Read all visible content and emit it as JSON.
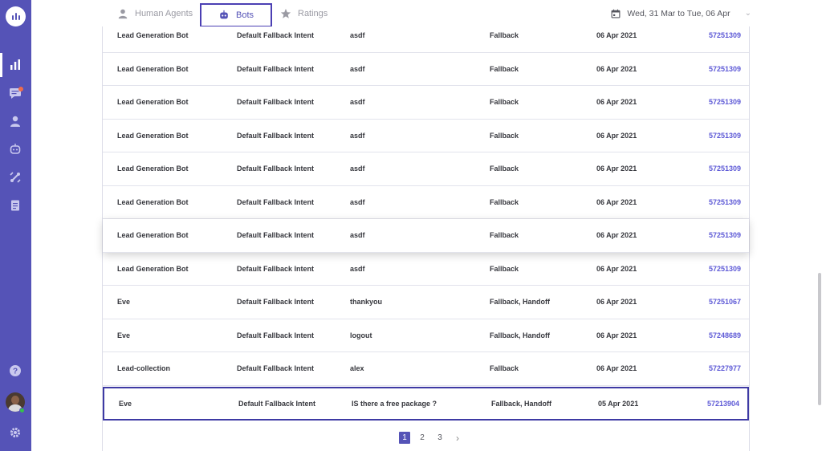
{
  "sidebar": {
    "icons": [
      "logo-icon",
      "analytics-icon",
      "conversations-icon",
      "contacts-icon",
      "bot-icon",
      "integrations-icon",
      "reports-icon",
      "help-icon",
      "settings-icon"
    ]
  },
  "tabs": [
    {
      "label": "Human Agents"
    },
    {
      "label": "Bots"
    },
    {
      "label": "Ratings"
    }
  ],
  "date_range": "Wed, 31 Mar to Tue, 06 Apr",
  "rows": [
    {
      "bot": "Lead Generation Bot",
      "intent": "Default Fallback Intent",
      "message": "asdf",
      "type": "Fallback",
      "date": "06 Apr 2021",
      "id": "57251309"
    },
    {
      "bot": "Lead Generation Bot",
      "intent": "Default Fallback Intent",
      "message": "asdf",
      "type": "Fallback",
      "date": "06 Apr 2021",
      "id": "57251309"
    },
    {
      "bot": "Lead Generation Bot",
      "intent": "Default Fallback Intent",
      "message": "asdf",
      "type": "Fallback",
      "date": "06 Apr 2021",
      "id": "57251309"
    },
    {
      "bot": "Lead Generation Bot",
      "intent": "Default Fallback Intent",
      "message": "asdf",
      "type": "Fallback",
      "date": "06 Apr 2021",
      "id": "57251309"
    },
    {
      "bot": "Lead Generation Bot",
      "intent": "Default Fallback Intent",
      "message": "asdf",
      "type": "Fallback",
      "date": "06 Apr 2021",
      "id": "57251309"
    },
    {
      "bot": "Lead Generation Bot",
      "intent": "Default Fallback Intent",
      "message": "asdf",
      "type": "Fallback",
      "date": "06 Apr 2021",
      "id": "57251309"
    },
    {
      "bot": "Lead Generation Bot",
      "intent": "Default Fallback Intent",
      "message": "asdf",
      "type": "Fallback",
      "date": "06 Apr 2021",
      "id": "57251309"
    },
    {
      "bot": "Lead Generation Bot",
      "intent": "Default Fallback Intent",
      "message": "asdf",
      "type": "Fallback",
      "date": "06 Apr 2021",
      "id": "57251309"
    },
    {
      "bot": "Eve",
      "intent": "Default Fallback Intent",
      "message": "thankyou",
      "type": "Fallback, Handoff",
      "date": "06 Apr 2021",
      "id": "57251067"
    },
    {
      "bot": "Eve",
      "intent": "Default Fallback Intent",
      "message": "logout",
      "type": "Fallback, Handoff",
      "date": "06 Apr 2021",
      "id": "57248689"
    },
    {
      "bot": "Lead-collection",
      "intent": "Default Fallback Intent",
      "message": "alex",
      "type": "Fallback",
      "date": "06 Apr 2021",
      "id": "57227977"
    },
    {
      "bot": "Eve",
      "intent": "Default Fallback Intent",
      "message": "IS there a free package ?",
      "type": "Fallback, Handoff",
      "date": "05 Apr 2021",
      "id": "57213904"
    }
  ],
  "pagination": {
    "pages": [
      "1",
      "2",
      "3"
    ],
    "current": "1",
    "next_icon": "chevron-right-icon"
  },
  "colors": {
    "sidebar": "#5553b7",
    "accent": "#5d59d6",
    "highlight_border": "#3e3aa4"
  }
}
